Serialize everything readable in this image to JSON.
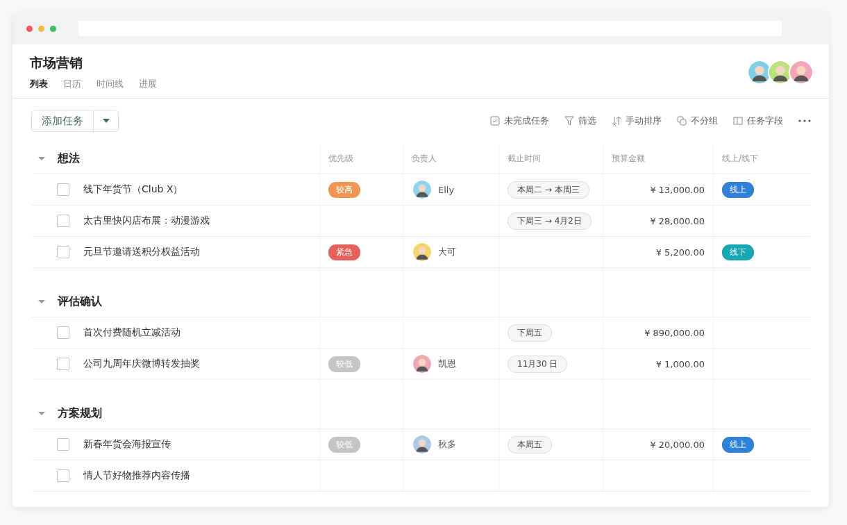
{
  "project": {
    "title": "市场营销"
  },
  "tabs": [
    {
      "label": "列表",
      "selected": true
    },
    {
      "label": "日历",
      "selected": false
    },
    {
      "label": "时间线",
      "selected": false
    },
    {
      "label": "进展",
      "selected": false
    }
  ],
  "members": [
    {
      "color": "#7fd0e8"
    },
    {
      "color": "#b9e27a"
    },
    {
      "color": "#f4a6b8"
    }
  ],
  "add_task": {
    "label": "添加任务"
  },
  "toolbar": [
    {
      "kind": "check",
      "label": "未完成任务"
    },
    {
      "kind": "filter",
      "label": "筛选"
    },
    {
      "kind": "sort",
      "label": "手动排序"
    },
    {
      "kind": "group",
      "label": "不分组"
    },
    {
      "kind": "fields",
      "label": "任务字段"
    },
    {
      "kind": "more"
    }
  ],
  "columns": [
    "优先级",
    "负责人",
    "截止时间",
    "预算金额",
    "线上/线下"
  ],
  "groups": [
    {
      "name": "想法",
      "expanded": true,
      "tasks": [
        {
          "name": "线下年货节（Club X）",
          "checked": false,
          "priority": {
            "label": "较高",
            "color": "#ef9650"
          },
          "assignee": {
            "name": "Elly",
            "color": "#8fd3ef"
          },
          "deadline": "本周二 → 本周三",
          "budget": "¥ 13,000.00",
          "channel": {
            "label": "线上",
            "color": "#2f80d8"
          }
        },
        {
          "name": "太古里快闪店布展：动漫游戏",
          "checked": false,
          "deadline": "下周三 → 4月2日",
          "budget": "¥ 28,000.00"
        },
        {
          "name": "元旦节邀请送积分权益活动",
          "checked": false,
          "priority": {
            "label": "紧急",
            "color": "#e8605a"
          },
          "assignee": {
            "name": "大可",
            "color": "#f5d56b"
          },
          "budget": "¥ 5,200.00",
          "channel": {
            "label": "线下",
            "color": "#13a8b4"
          }
        }
      ]
    },
    {
      "name": "评估确认",
      "expanded": true,
      "tasks": [
        {
          "name": "首次付费随机立减活动",
          "checked": false,
          "deadline": "下周五",
          "budget": "¥ 890,000.00"
        },
        {
          "name": "公司九周年庆微博转发抽奖",
          "checked": false,
          "priority": {
            "label": "较低",
            "color": "#c4c4c4"
          },
          "assignee": {
            "name": "凯恩",
            "color": "#f2a5b5"
          },
          "deadline": "11月30 日",
          "budget": "¥ 1,000.00"
        }
      ]
    },
    {
      "name": "方案规划",
      "expanded": true,
      "tasks": [
        {
          "name": "新春年货会海报宣传",
          "checked": false,
          "priority": {
            "label": "较低",
            "color": "#c4c4c4"
          },
          "assignee": {
            "name": "秋多",
            "color": "#a9c6ea"
          },
          "deadline": "本周五",
          "budget": "¥ 20,000.00",
          "channel": {
            "label": "线上",
            "color": "#2f80d8"
          }
        },
        {
          "name": "情人节好物推荐内容传播",
          "checked": false
        }
      ]
    }
  ]
}
